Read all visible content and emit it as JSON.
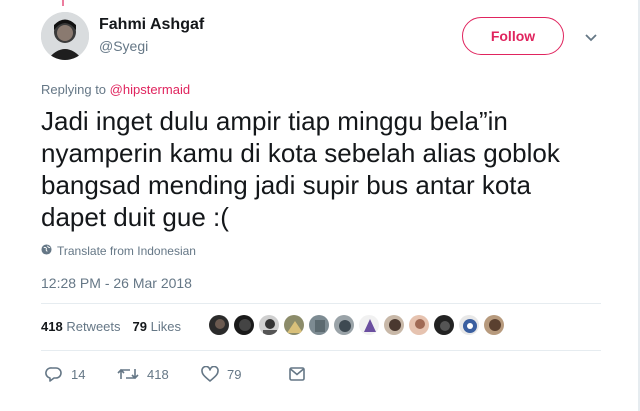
{
  "author": {
    "name": "Fahmi Ashgaf",
    "handle": "@Syegi"
  },
  "follow_label": "Follow",
  "reply_context": {
    "prefix": "Replying to",
    "mention": "@hipstermaid"
  },
  "tweet": {
    "lines": [
      "Jadi inget dulu ampir tiap minggu bela”in",
      "nyamperin kamu di kota sebelah alias goblok",
      "bangsad mending jadi supir bus antar kota",
      "dapet duit gue :("
    ]
  },
  "translate_label": "Translate from Indonesian",
  "timestamp": "12:28 PM - 26 Mar 2018",
  "stats": {
    "retweets_count": "418",
    "retweets_label": "Retweets",
    "likes_count": "79",
    "likes_label": "Likes"
  },
  "actions": {
    "reply_count": "14",
    "retweet_count": "418",
    "like_count": "79"
  },
  "colors": {
    "accent": "#e0245e",
    "secondary_text": "#657786",
    "divider": "#e6ecf0"
  },
  "icons": [
    "chevron-down-icon",
    "globe-icon",
    "reply-icon",
    "retweet-icon",
    "heart-icon",
    "message-icon"
  ]
}
